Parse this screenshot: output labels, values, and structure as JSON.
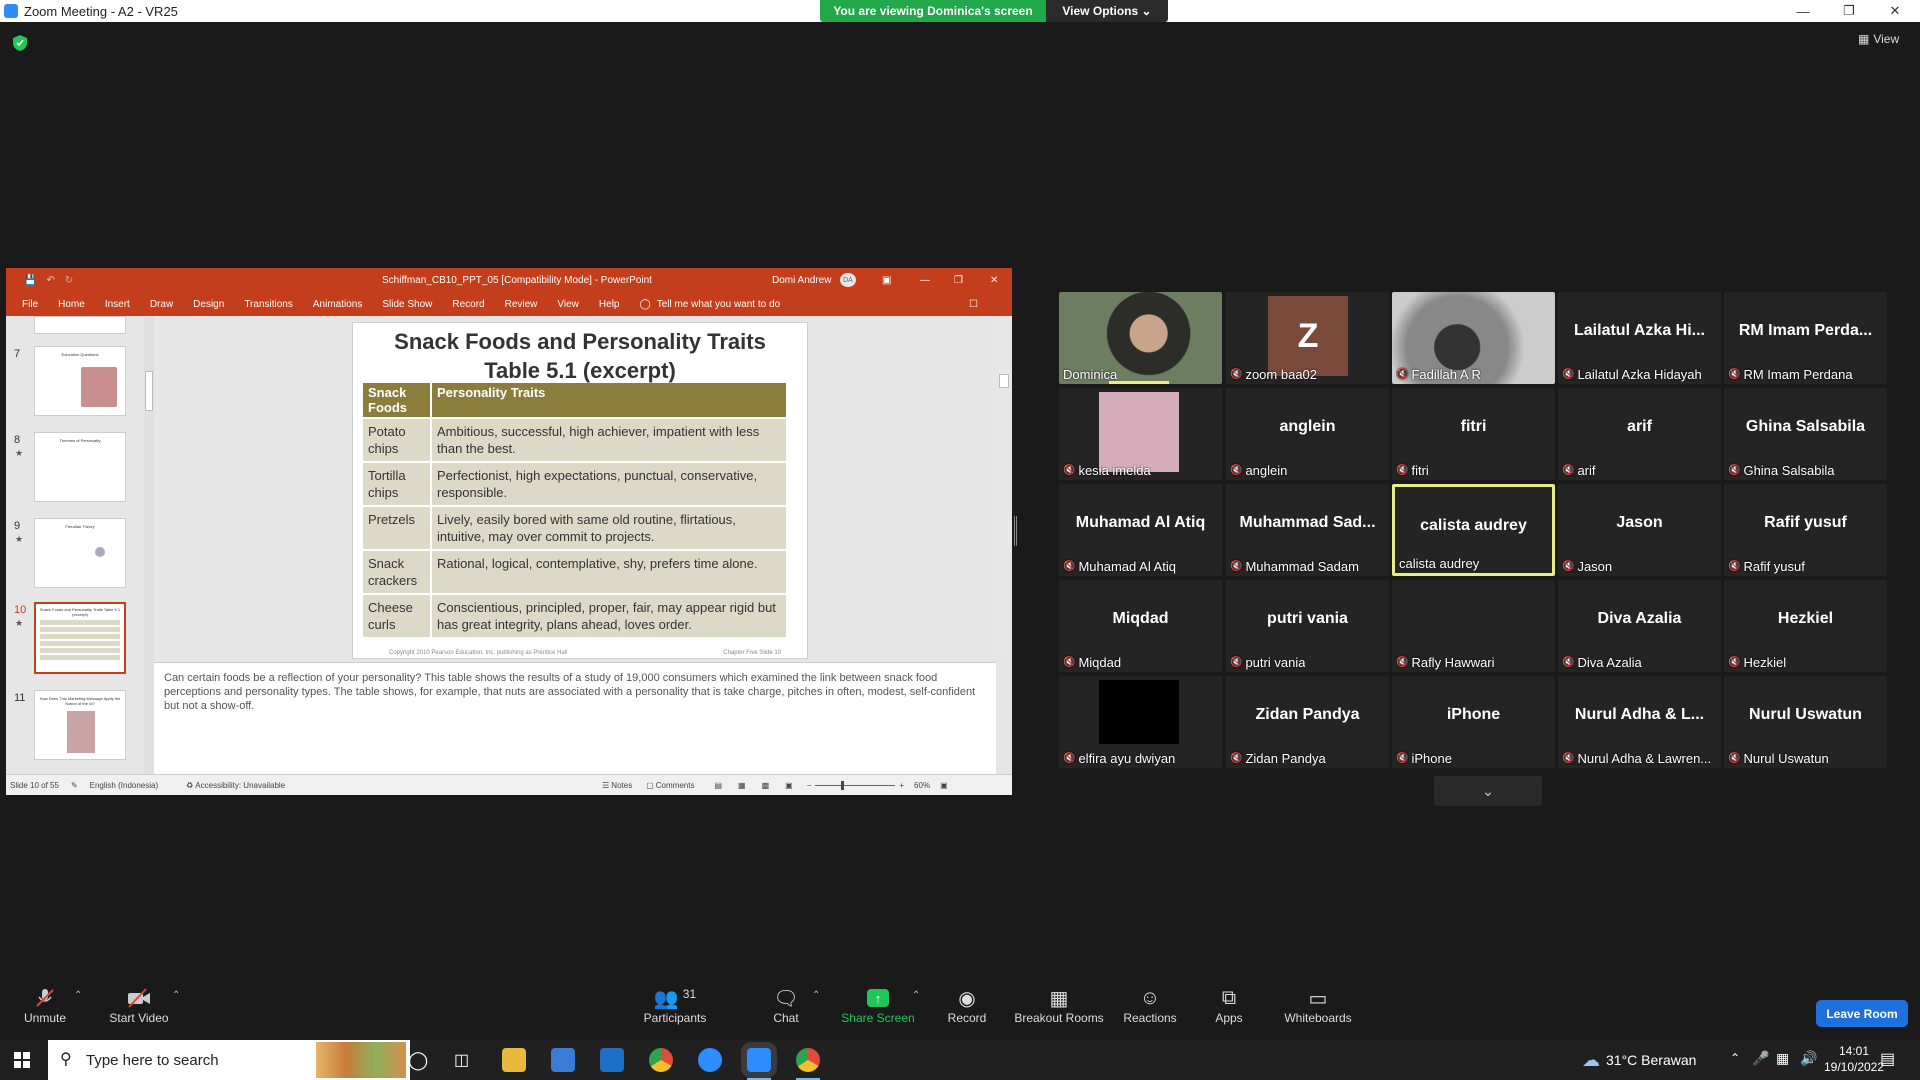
{
  "window": {
    "title": "Zoom Meeting - A2 - VR25"
  },
  "banner": {
    "viewing": "You are viewing Dominica's screen",
    "view_options": "View Options"
  },
  "top_right": {
    "view": "View"
  },
  "powerpoint": {
    "title": "Schiffman_CB10_PPT_05 [Compatibility Mode] - PowerPoint",
    "user": "Domi Andrew",
    "user_initials": "DA",
    "ribbon": [
      "File",
      "Home",
      "Insert",
      "Draw",
      "Design",
      "Transitions",
      "Animations",
      "Slide Show",
      "Record",
      "Review",
      "View",
      "Help"
    ],
    "tell_me": "Tell me what you want to do",
    "thumb_numbers": [
      "7",
      "8",
      "9",
      "10",
      "11"
    ],
    "thumb_titles": [
      "Education Questions",
      "Theories of Personality",
      "Freudian Theory",
      "Snack Foods and Personality Traits Table 5.1 (excerpt)",
      "How Does This Marketing Message Apply the Notion of the Id?"
    ],
    "slide": {
      "title_line1": "Snack Foods and Personality Traits",
      "title_line2": "Table 5.1 (excerpt)",
      "headers": [
        "Snack Foods",
        "Personality Traits"
      ],
      "rows": [
        [
          "Potato chips",
          "Ambitious, successful, high achiever, impatient with less than the best."
        ],
        [
          "Tortilla chips",
          "Perfectionist, high expectations, punctual, conservative, responsible."
        ],
        [
          "Pretzels",
          "Lively, easily bored with same old routine, flirtatious, intuitive, may over commit to projects."
        ],
        [
          "Snack crackers",
          "Rational, logical, contemplative, shy, prefers time alone."
        ],
        [
          "Cheese curls",
          "Conscientious, principled, proper, fair, may appear rigid but has great integrity, plans ahead, loves order."
        ]
      ],
      "footer_left": "Copyright 2010 Pearson Education, Inc. publishing as Prentice Hall",
      "footer_right": "Chapter Five Slide 10"
    },
    "notes": "Can certain foods be a reflection of your personality?  This table shows the results of a study of 19,000 consumers which examined the link between snack food perceptions and personality types.  The table shows, for example, that nuts are associated with a personality that is take charge, pitches in often, modest, self-confident but not a show-off.",
    "status": {
      "slide": "Slide 10 of 55",
      "language": "English (Indonesia)",
      "accessibility": "Accessibility: Unavailable",
      "notes": "Notes",
      "comments": "Comments",
      "zoom": "60%"
    }
  },
  "participants": [
    {
      "big": "",
      "name": "Dominica",
      "muted": false,
      "video": "photo-woman"
    },
    {
      "big": "Z",
      "name": "zoom baa02",
      "muted": true,
      "video": "avatar-z"
    },
    {
      "big": "",
      "name": "Fadillah A R",
      "muted": true,
      "video": "photo-blur"
    },
    {
      "big": "Lailatul Azka Hi...",
      "name": "Lailatul Azka Hidayah",
      "muted": true,
      "video": ""
    },
    {
      "big": "RM Imam Perda...",
      "name": "RM Imam Perdana",
      "muted": true,
      "video": ""
    },
    {
      "big": "",
      "name": "kesia imelda",
      "muted": true,
      "video": "pink-block"
    },
    {
      "big": "anglein",
      "name": "anglein",
      "muted": true,
      "video": ""
    },
    {
      "big": "fitri",
      "name": "fitri",
      "muted": true,
      "video": ""
    },
    {
      "big": "arif",
      "name": "arif",
      "muted": true,
      "video": ""
    },
    {
      "big": "Ghina Salsabila",
      "name": "Ghina Salsabila",
      "muted": true,
      "video": ""
    },
    {
      "big": "Muhamad Al Atiq",
      "name": "Muhamad Al Atiq",
      "muted": true,
      "video": ""
    },
    {
      "big": "Muhammad  Sad...",
      "name": "Muhammad Sadam",
      "muted": true,
      "video": ""
    },
    {
      "big": "calista audrey",
      "name": "calista audrey",
      "muted": false,
      "video": "",
      "active": true
    },
    {
      "big": "Jason",
      "name": "Jason",
      "muted": true,
      "video": ""
    },
    {
      "big": "Rafif yusuf",
      "name": "Rafif yusuf",
      "muted": true,
      "video": ""
    },
    {
      "big": "Miqdad",
      "name": "Miqdad",
      "muted": true,
      "video": ""
    },
    {
      "big": "putri vania",
      "name": "putri vania",
      "muted": true,
      "video": ""
    },
    {
      "big": "",
      "name": "Rafly Hawwari",
      "muted": true,
      "video": "dark"
    },
    {
      "big": "Diva Azalia",
      "name": "Diva Azalia",
      "muted": true,
      "video": ""
    },
    {
      "big": "Hezkiel",
      "name": "Hezkiel",
      "muted": true,
      "video": ""
    },
    {
      "big": "",
      "name": "elfira ayu dwiyan",
      "muted": true,
      "video": "black-block"
    },
    {
      "big": "Zidan Pandya",
      "name": "Zidan Pandya",
      "muted": true,
      "video": ""
    },
    {
      "big": "iPhone",
      "name": "iPhone",
      "muted": true,
      "video": ""
    },
    {
      "big": "Nurul Adha & L...",
      "name": "Nurul Adha & Lawren...",
      "muted": true,
      "video": ""
    },
    {
      "big": "Nurul Uswatun",
      "name": "Nurul Uswatun",
      "muted": true,
      "video": ""
    }
  ],
  "toolbar": {
    "unmute": "Unmute",
    "start_video": "Start Video",
    "participants": "Participants",
    "participants_count": "31",
    "chat": "Chat",
    "share_screen": "Share Screen",
    "record": "Record",
    "breakout": "Breakout Rooms",
    "reactions": "Reactions",
    "apps": "Apps",
    "whiteboards": "Whiteboards",
    "leave": "Leave Room"
  },
  "taskbar": {
    "search_placeholder": "Type here to search",
    "weather": "31°C  Berawan",
    "time": "14:01",
    "date": "19/10/2022"
  },
  "colors": {
    "zoom_blue": "#1f6fdd",
    "share_green": "#22a84a",
    "ppt_red": "#c43e1c",
    "table_header": "#8c7d3c",
    "table_cell": "#ddd9c7",
    "active_speaker": "#e9ed87",
    "muted_red": "#e0403c"
  }
}
